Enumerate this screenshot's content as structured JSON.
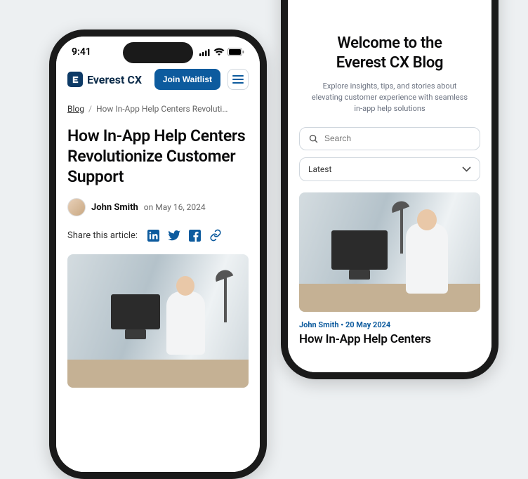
{
  "status": {
    "time": "9:41"
  },
  "brand": {
    "name": "Everest CX"
  },
  "header": {
    "waitlist_label": "Join Waitlist"
  },
  "article": {
    "breadcrumb_root": "Blog",
    "breadcrumb_current": "How In-App Help Centers Revolutionize Custom...",
    "title": "How In-App Help Centers Revolutionize Customer Support",
    "author": "John Smith",
    "date_prefix": "on",
    "date": "May 16, 2024",
    "share_label": "Share this article:"
  },
  "blog": {
    "title_line1": "Welcome to the",
    "title_line2": "Everest CX Blog",
    "subtitle": "Explore insights, tips, and stories about elevating customer experience with seamless in-app help solutions",
    "search_placeholder": "Search",
    "sort_selected": "Latest",
    "card_author": "John Smith",
    "card_sep": "•",
    "card_date": "20 May 2024",
    "card_title": "How In-App Help Centers"
  }
}
